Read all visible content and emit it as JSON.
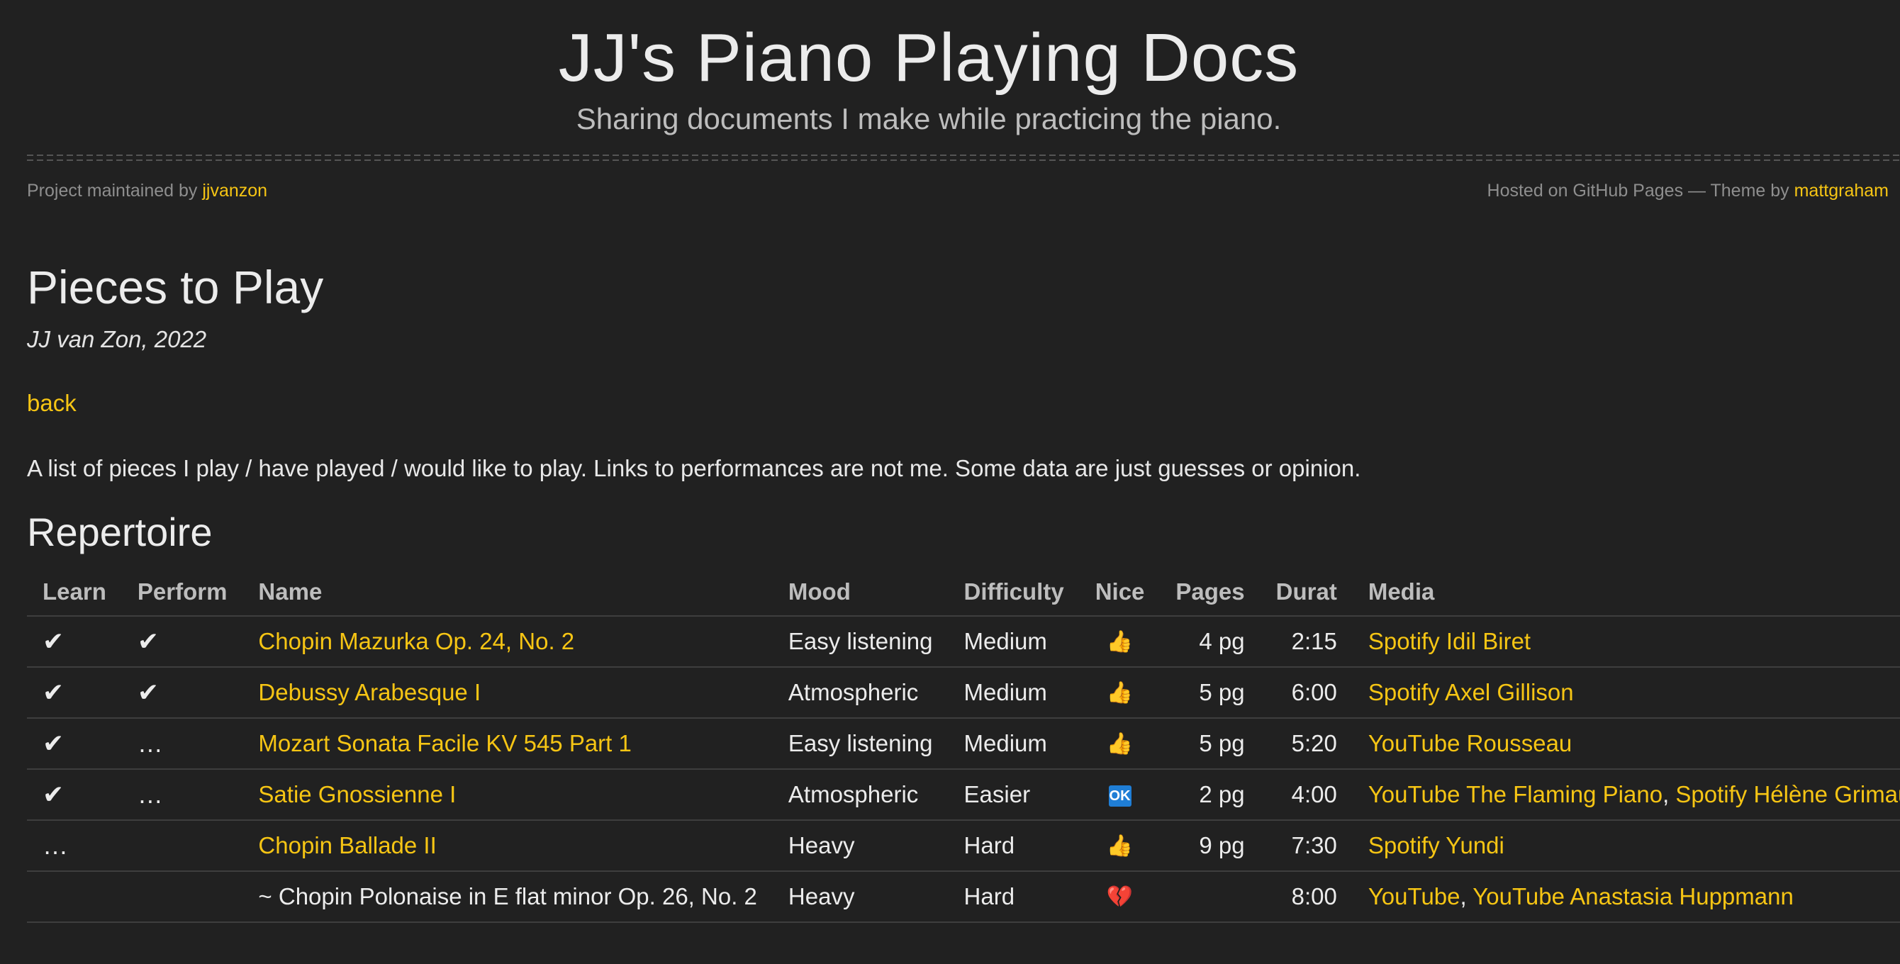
{
  "site": {
    "title": "JJ's Piano Playing Docs",
    "subtitle": "Sharing documents I make while practicing the piano.",
    "maintained_prefix": "Project maintained by ",
    "maintainer": "jjvanzon",
    "hosted_text": "Hosted on GitHub Pages — Theme by ",
    "theme_author": "mattgraham"
  },
  "page": {
    "title": "Pieces to Play",
    "author": "JJ van Zon, 2022",
    "back_label": "back",
    "intro": "A list of pieces I play / have played / would like to play. Links to performances are not me. Some data are just guesses or opinion.",
    "section_title": "Repertoire"
  },
  "table": {
    "headers": {
      "learn": "Learn",
      "perform": "Perform",
      "name": "Name",
      "mood": "Mood",
      "difficulty": "Difficulty",
      "nice": "Nice",
      "pages": "Pages",
      "duration": "Durat",
      "media": "Media"
    },
    "rows": [
      {
        "learn": "✔",
        "perform": "✔",
        "name": "Chopin Mazurka Op. 24, No. 2",
        "name_is_link": true,
        "mood": "Easy listening",
        "difficulty": "Medium",
        "nice": "👍",
        "nice_icon": "thumbs-up-icon",
        "pages": "4 pg",
        "duration": "2:15",
        "media": [
          "Spotify Idil Biret"
        ]
      },
      {
        "learn": "✔",
        "perform": "✔",
        "name": "Debussy Arabesque I",
        "name_is_link": true,
        "mood": "Atmospheric",
        "difficulty": "Medium",
        "nice": "👍",
        "nice_icon": "thumbs-up-icon",
        "pages": "5 pg",
        "duration": "6:00",
        "media": [
          "Spotify Axel Gillison"
        ]
      },
      {
        "learn": "✔",
        "perform": "…",
        "name": "Mozart Sonata Facile KV 545 Part 1",
        "name_is_link": true,
        "mood": "Easy listening",
        "difficulty": "Medium",
        "nice": "👍",
        "nice_icon": "thumbs-up-icon",
        "pages": "5 pg",
        "duration": "5:20",
        "media": [
          "YouTube Rousseau"
        ]
      },
      {
        "learn": "✔",
        "perform": "…",
        "name": "Satie Gnossienne I",
        "name_is_link": true,
        "mood": "Atmospheric",
        "difficulty": "Easier",
        "nice": "OK",
        "nice_icon": "ok-icon",
        "pages": "2 pg",
        "duration": "4:00",
        "media": [
          "YouTube The Flaming Piano",
          "Spotify Hélène Grimaud"
        ]
      },
      {
        "learn": "…",
        "perform": "",
        "name": "Chopin Ballade II",
        "name_is_link": true,
        "mood": "Heavy",
        "difficulty": "Hard",
        "nice": "👍",
        "nice_icon": "thumbs-up-icon",
        "pages": "9 pg",
        "duration": "7:30",
        "media": [
          "Spotify Yundi"
        ]
      },
      {
        "learn": "",
        "perform": "",
        "name": "~ Chopin Polonaise in E flat minor Op. 26, No. 2",
        "name_is_link": false,
        "mood": "Heavy",
        "difficulty": "Hard",
        "nice": "💔",
        "nice_icon": "broken-heart-icon",
        "pages": "",
        "duration": "8:00",
        "media": [
          "YouTube",
          "YouTube Anastasia Huppmann"
        ]
      }
    ]
  },
  "colors": {
    "background": "#212121",
    "link": "#f6c514",
    "text": "#e4e4e4",
    "muted": "#8e8e8e"
  }
}
